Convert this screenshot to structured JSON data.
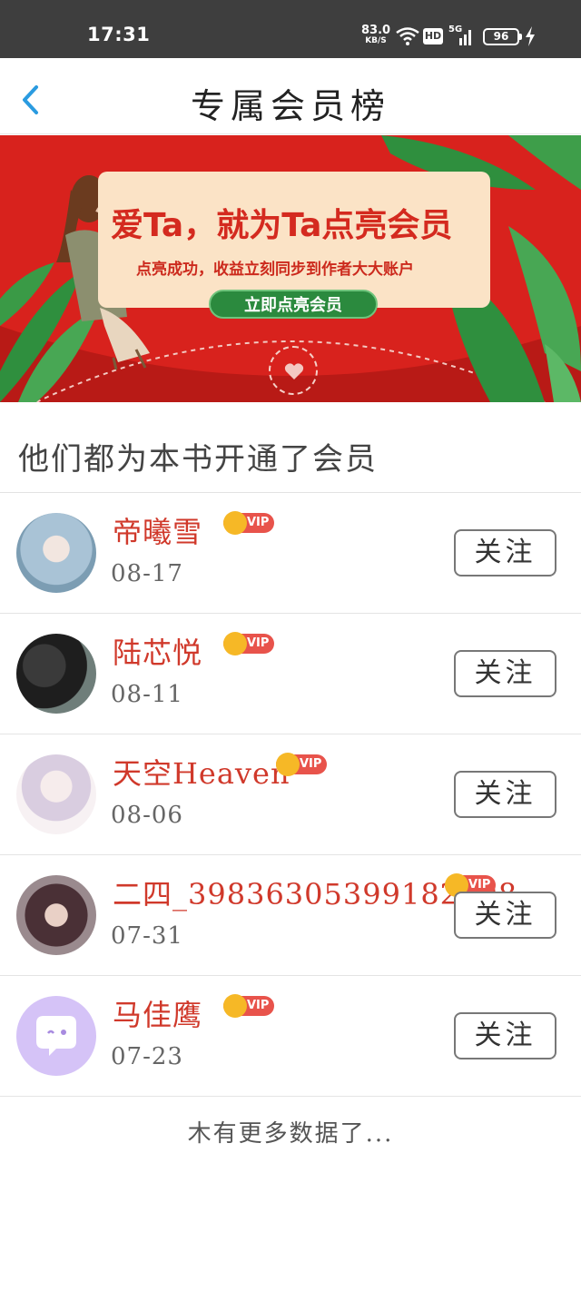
{
  "status_bar": {
    "time": "17:31",
    "net_speed_value": "83.0",
    "net_speed_unit": "KB/S",
    "hd_label": "HD",
    "signal_label": "5G",
    "battery_level": "96"
  },
  "header": {
    "title": "专属会员榜"
  },
  "banner": {
    "headline": "爱Ta，就为Ta点亮会员",
    "subtext": "点亮成功，收益立刻同步到作者大大账户",
    "button_label": "立即点亮会员"
  },
  "section": {
    "title": "他们都为本书开通了会员"
  },
  "members": [
    {
      "name": "帝曦雪",
      "date": "08-17",
      "badge": "VIP",
      "follow_label": "关注",
      "avatar_color": "#8fb3c9"
    },
    {
      "name": "陆芯悦",
      "date": "08-11",
      "badge": "VIP",
      "follow_label": "关注",
      "avatar_color": "#2b2b2b"
    },
    {
      "name": "天空Heaven",
      "date": "08-06",
      "badge": "VIP",
      "follow_label": "关注",
      "avatar_color": "#e9dde8"
    },
    {
      "name": "二四_39836305399182898",
      "date": "07-31",
      "badge": "VIP",
      "follow_label": "关注",
      "avatar_color": "#6b4d57"
    },
    {
      "name": "马佳鹰",
      "date": "07-23",
      "badge": "VIP",
      "follow_label": "关注",
      "avatar_color": "#d5c3f7"
    }
  ],
  "footer": {
    "no_more_text": "木有更多数据了..."
  },
  "colors": {
    "banner_red": "#d8221d",
    "name_red": "#d0392b",
    "vip_red": "#e8534b",
    "crown_gold": "#f6b826",
    "back_blue": "#2a9be0"
  }
}
